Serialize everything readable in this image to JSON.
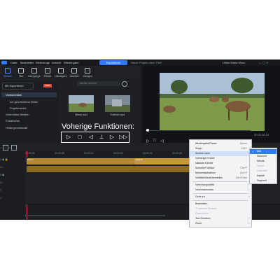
{
  "menubar": {
    "items": [
      "Datei",
      "Bearbeiten",
      "Werkzeuge",
      "Ansicht",
      "Wiedergabe"
    ],
    "publish_label": "Exportieren",
    "project_title": "Neuer Projekt ohne Titel*",
    "user": "Ulrike Maria Mono"
  },
  "toolbar": {
    "items": [
      "Medien",
      "Titel",
      "Übergänge",
      "Effekte",
      "Überlagern",
      "Übertitel",
      "Vorlagen"
    ]
  },
  "sidebar": {
    "import_label": "Mit Importieren",
    "badge": "NEW",
    "items": [
      "Videomedien",
      "Ich geschnittene Bilder",
      "Projektmedia",
      "Unterstützt Medien",
      "Fotobücher",
      "Hintergrundmusik"
    ]
  },
  "library": {
    "search_placeholder": "Medien suchen",
    "thumbs": [
      {
        "label": "Hirsch.mp4"
      },
      {
        "label": "Kollision.mp4"
      }
    ]
  },
  "overlay": {
    "title": "Voherige Funktionen:",
    "icons": [
      "play-icon",
      "stop-icon",
      "prev-frame-icon",
      "split-icon",
      "next-frame-icon",
      "fast-forward-icon"
    ]
  },
  "preview": {
    "timecode": "00 00 06 14"
  },
  "timeline": {
    "ruler": [
      "00:00:00",
      "00:00:05",
      "00:00:10",
      "00:00:15",
      "00:00:20",
      "00:00:25",
      "00:00:30"
    ],
    "clips": [
      {
        "label": "Hirsch"
      },
      {
        "label": "Kollision"
      }
    ]
  },
  "context_menu": {
    "items": [
      {
        "label": "Wiedergabe/Pause",
        "shortcut": "Space",
        "disabled": false
      },
      {
        "label": "Stopp",
        "shortcut": "Ctrl+/",
        "disabled": false
      },
      {
        "label": "Suchen nach",
        "shortcut": "",
        "disabled": false,
        "submenu": true,
        "highlight": true
      },
      {
        "label": "Vorherige Einheit",
        "shortcut": ",",
        "disabled": false
      },
      {
        "label": "Nächste Einheit",
        "shortcut": ".",
        "disabled": false
      },
      {
        "label": "Schneller Vorlauf",
        "shortcut": "Ctrl+F",
        "disabled": false
      },
      {
        "label": "Momentaufnahme",
        "shortcut": "Ctrl+P",
        "disabled": false
      },
      {
        "label": "Vollbild/Wiederherstellen",
        "shortcut": "Ctrl+Enter",
        "disabled": false
      },
      {
        "label": "Vorschauqualität",
        "shortcut": "",
        "disabled": false,
        "submenu": true
      },
      {
        "label": "Vorschaumodus",
        "shortcut": "",
        "disabled": false,
        "submenu": true
      },
      {
        "label": "Gehe zu",
        "shortcut": "",
        "disabled": false,
        "submenu": true
      },
      {
        "label": "Bearbeiten",
        "shortcut": "",
        "disabled": false
      },
      {
        "label": "TV-sichere Bereich",
        "shortcut": "",
        "disabled": true
      },
      {
        "label": "Rasterlinien",
        "shortcut": "",
        "disabled": true
      },
      {
        "label": "Tool Snoeken",
        "shortcut": "",
        "disabled": false,
        "submenu": true
      },
      {
        "label": "Zoom",
        "shortcut": "",
        "disabled": false,
        "submenu": true
      }
    ]
  },
  "submenu": {
    "items": [
      {
        "label": "Bild",
        "checked": true,
        "disabled": false,
        "highlight": false
      },
      {
        "label": "Sekunde",
        "checked": false,
        "disabled": false,
        "highlight": false
      },
      {
        "label": "Minute",
        "checked": false,
        "disabled": false,
        "highlight": false
      },
      {
        "label": "Szene",
        "checked": false,
        "disabled": true,
        "highlight": false
      },
      {
        "label": "Untertitel",
        "checked": false,
        "disabled": true,
        "highlight": false
      },
      {
        "label": "Kapitel",
        "checked": false,
        "disabled": false,
        "highlight": false
      },
      {
        "label": "Segment",
        "checked": false,
        "disabled": false,
        "highlight": false
      }
    ]
  },
  "colors": {
    "accent": "#2d7cff",
    "menu_bg": "#f2f3f5",
    "app_bg": "#1b1d22"
  }
}
